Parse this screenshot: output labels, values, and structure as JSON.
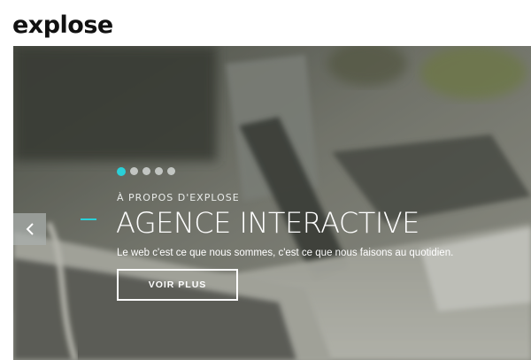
{
  "header": {
    "logo_text": "explose"
  },
  "hero": {
    "slider": {
      "dot_count": 5,
      "active_index": 0
    },
    "eyebrow": "À PROPOS D'EXPLOSE",
    "title": "AGENCE INTERACTIVE",
    "tagline": "Le web c'est ce que nous sommes, c'est ce que nous faisons au quotidien.",
    "cta_label": "VOIR PLUS",
    "prev_icon": "chevron-left-icon"
  },
  "colors": {
    "accent": "#2ad0d8",
    "text_on_hero": "#ffffff",
    "logo": "#111111"
  }
}
